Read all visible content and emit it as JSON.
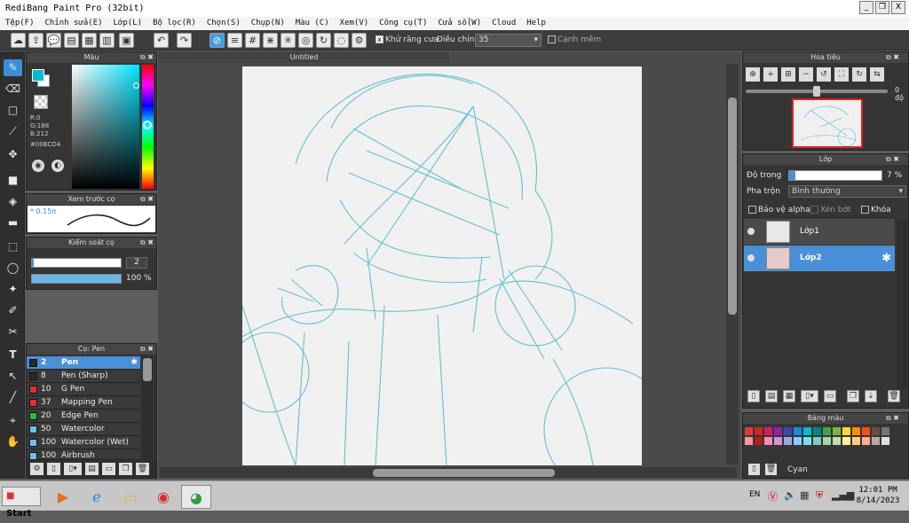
{
  "window": {
    "title": "RediBang Paint Pro (32bit)",
    "min": "_",
    "max": "❐",
    "close": "X"
  },
  "menu": [
    "Tệp(F)",
    "Chỉnh sửa(E)",
    "Lớp(L)",
    "Bộ lọc(R)",
    "Chọn(S)",
    "Chụp(N)",
    "Màu (C)",
    "Xem(V)",
    "Công cụ(T)",
    "Cửa sổ(W)",
    "Cloud",
    "Help"
  ],
  "toolbar": {
    "antialias_label": "Khử răng cưa",
    "antialias_checked": "x",
    "adjust_label": "Điều chỉnh",
    "adjust_value": "35",
    "edge_label": "Cạnh mềm"
  },
  "document": {
    "tab": "Untitled"
  },
  "color_panel": {
    "title": "Màu",
    "r": "R:0",
    "g": "G:188",
    "b": "B:212",
    "hex": "#00BCD4",
    "main_color": "#00bcd4"
  },
  "brush_preview": {
    "title": "Xem trước cọ",
    "size": "0.15π"
  },
  "brush_control": {
    "title": "Kiểm soát cọ",
    "size": "2",
    "opacity": "100 %"
  },
  "brush_list": {
    "title": "Cọ: Pen",
    "items": [
      {
        "size": "2",
        "name": "Pen",
        "color": "#2a2a2a"
      },
      {
        "size": "8",
        "name": "Pen (Sharp)",
        "color": "#2a2a2a"
      },
      {
        "size": "10",
        "name": "G Pen",
        "color": "#e03030"
      },
      {
        "size": "37",
        "name": "Mapping Pen",
        "color": "#e03030"
      },
      {
        "size": "20",
        "name": "Edge Pen",
        "color": "#2db84a"
      },
      {
        "size": "50",
        "name": "Watercolor",
        "color": "#6bc3ea"
      },
      {
        "size": "100",
        "name": "Watercolor (Wet)",
        "color": "#6bc3ea"
      },
      {
        "size": "100",
        "name": "Airbrush",
        "color": "#6bc3ea"
      }
    ]
  },
  "navigator": {
    "title": "Hoa tiêu",
    "angle": "0 độ"
  },
  "layers": {
    "title": "Lớp",
    "opacity_label": "Độ trong",
    "opacity_value": "7 %",
    "blend_label": "Pha trộn",
    "blend_value": "Bình thường",
    "protect_alpha": "Bảo vệ alpha",
    "clip": "Xén bớt",
    "lock": "Khóa",
    "items": [
      {
        "name": "Lớp1"
      },
      {
        "name": "Lớp2"
      }
    ]
  },
  "palette": {
    "title": "Bảng màu",
    "current": "Cyan"
  },
  "taskbar": {
    "start": "Start",
    "lang": "EN",
    "time": "12:01 PM",
    "date": "8/14/2023"
  }
}
